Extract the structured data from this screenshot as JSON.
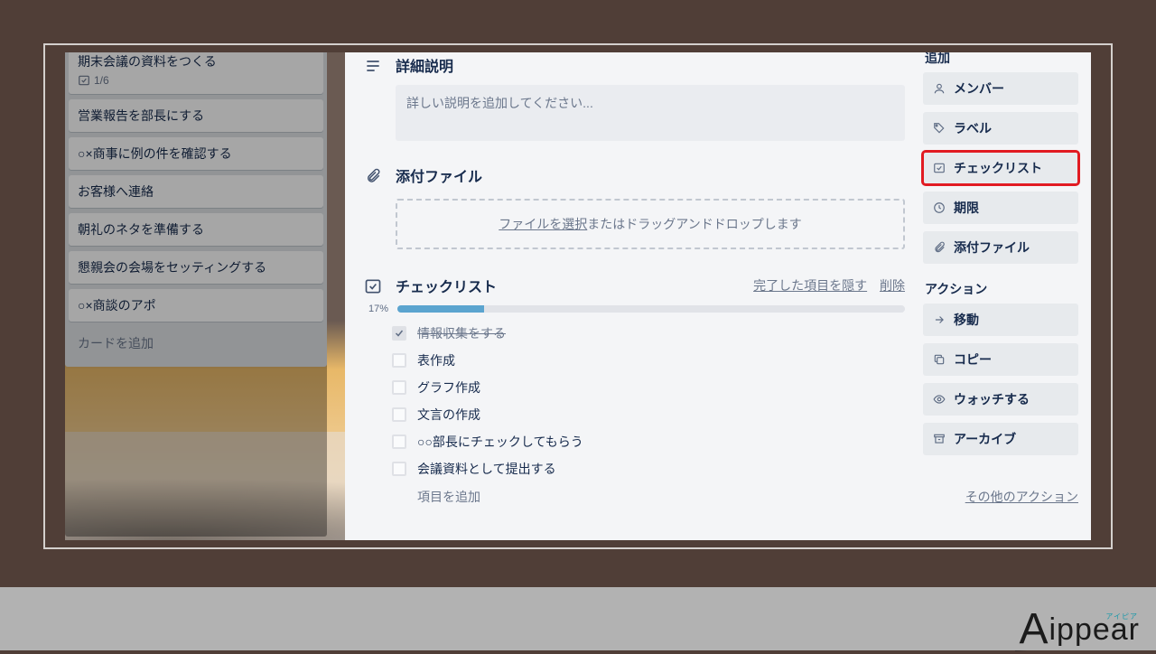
{
  "list": {
    "cards": [
      {
        "title": "期末会議の資料をつくる",
        "meta": "1/6"
      },
      {
        "title": "営業報告を部長にする"
      },
      {
        "title": "○×商事に例の件を確認する"
      },
      {
        "title": "お客様へ連絡"
      },
      {
        "title": "朝礼のネタを準備する"
      },
      {
        "title": "懇親会の会場をセッティングする"
      },
      {
        "title": "○×商談のアポ"
      }
    ],
    "add": "カードを追加"
  },
  "modal": {
    "desc": {
      "title": "詳細説明",
      "placeholder": "詳しい説明を追加してください..."
    },
    "attach": {
      "title": "添付ファイル",
      "link": "ファイルを選択",
      "rest": "またはドラッグアンドドロップします"
    },
    "checklist": {
      "title": "チェックリスト",
      "hide": "完了した項目を隠す",
      "delete": "削除",
      "pct": "17%",
      "fill": 17,
      "items": [
        {
          "label": "情報収集をする",
          "done": true
        },
        {
          "label": "表作成",
          "done": false
        },
        {
          "label": "グラフ作成",
          "done": false
        },
        {
          "label": "文言の作成",
          "done": false
        },
        {
          "label": "○○部長にチェックしてもらう",
          "done": false
        },
        {
          "label": "会議資料として提出する",
          "done": false
        }
      ],
      "add_item": "項目を追加"
    }
  },
  "side": {
    "add_heading": "追加",
    "add": [
      {
        "icon": "member",
        "label": "メンバー"
      },
      {
        "icon": "label",
        "label": "ラベル"
      },
      {
        "icon": "checklist",
        "label": "チェックリスト",
        "hl": true
      },
      {
        "icon": "clock",
        "label": "期限"
      },
      {
        "icon": "attach",
        "label": "添付ファイル"
      }
    ],
    "action_heading": "アクション",
    "actions": [
      {
        "icon": "arrow",
        "label": "移動"
      },
      {
        "icon": "copy",
        "label": "コピー"
      },
      {
        "icon": "watch",
        "label": "ウォッチする"
      },
      {
        "icon": "archive",
        "label": "アーカイブ"
      }
    ],
    "other": "その他のアクション"
  },
  "logo": {
    "text_big": "A",
    "text_rest": "ippear",
    "subtitle": "アイピア"
  }
}
